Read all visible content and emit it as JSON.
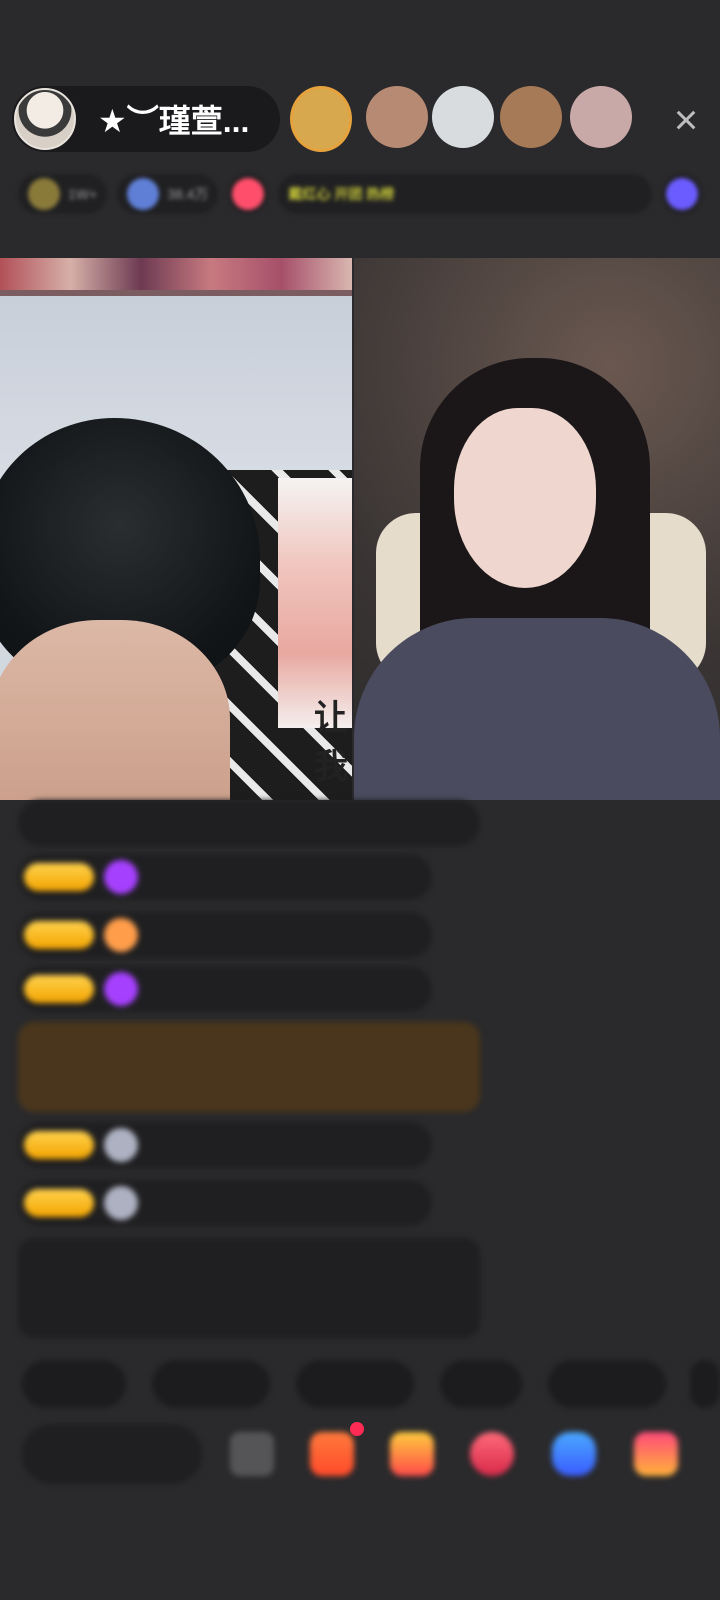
{
  "header": {
    "host_name": "★︶瑾萱...",
    "close_icon": "×",
    "viewer_avatar_colors": [
      "#d7a84e",
      "#b78a74",
      "#d8dcdf",
      "#a67a57",
      "#c9a8a8"
    ]
  },
  "badges": [
    {
      "text": "1W+",
      "color": "#8a7a3a",
      "style": ""
    },
    {
      "text": "38.4万",
      "color": "#5f7fd7",
      "style": ""
    },
    {
      "text": "",
      "color": "#ff4e6b",
      "style": ""
    },
    {
      "text": "戴红心 开团 热榜",
      "color": "#2c2c1a",
      "style": "yellow"
    },
    {
      "text": "",
      "color": "#6b5cff",
      "style": ""
    }
  ],
  "video": {
    "left_poster_text": "让我"
  },
  "chat": {
    "messages": [
      {
        "nick": "",
        "text": ""
      },
      {
        "nick": "",
        "text": ""
      },
      {
        "nick": "",
        "text": ""
      },
      {
        "nick": "",
        "text": ""
      },
      {
        "nick": "",
        "text": ""
      },
      {
        "nick": "",
        "text": ""
      }
    ],
    "rich_message": "",
    "system_message": ""
  },
  "quick_replies": [
    "",
    "",
    "",
    "",
    ""
  ],
  "bottom_bar": {
    "input_placeholder": "",
    "icons": [
      "emoji-icon",
      "gift-box-icon",
      "wallet-icon",
      "heart-gift-icon",
      "game-icon",
      "more-gift-icon"
    ]
  },
  "colors": {
    "background": "#2a2a2c",
    "pill": "#1a1a1c",
    "level_badge": "#f3a400",
    "system_text": "#8fcf56"
  }
}
